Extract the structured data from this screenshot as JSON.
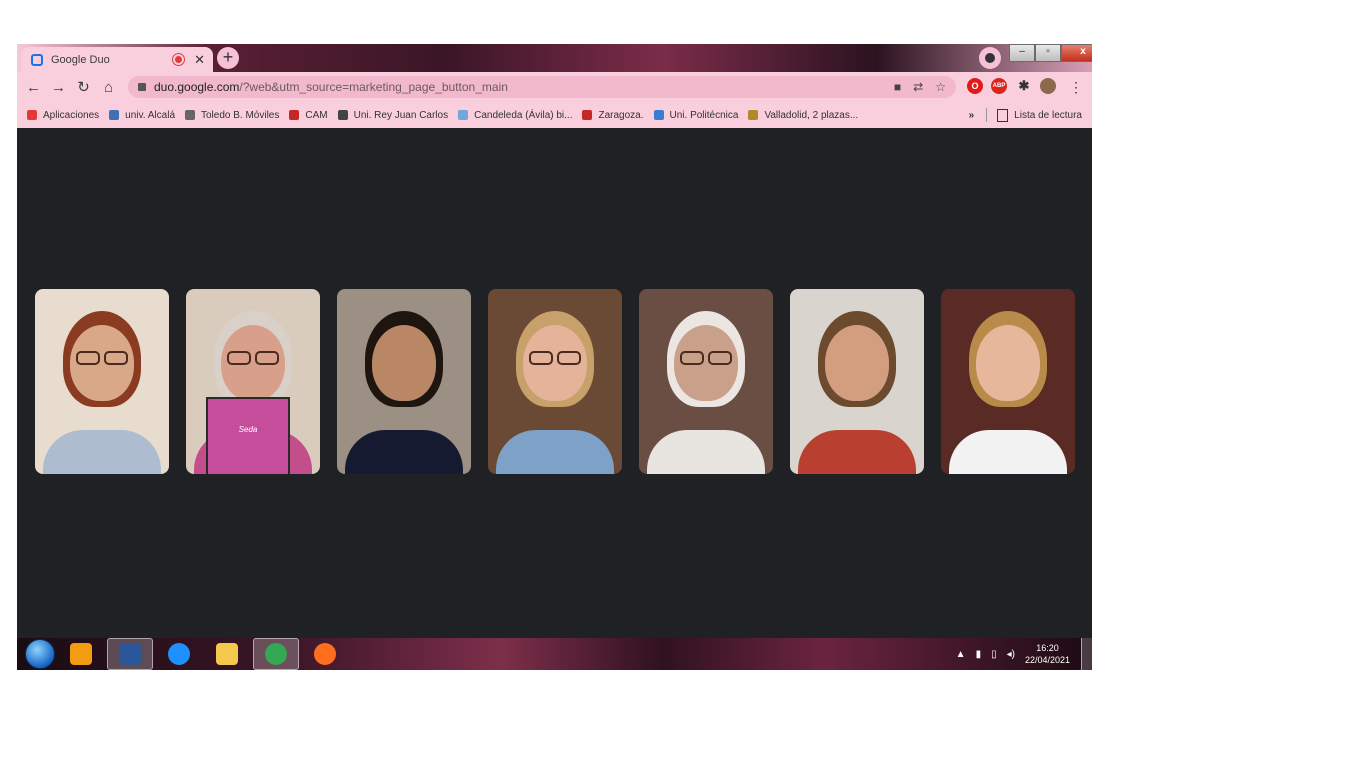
{
  "browser": {
    "tab_title": "Google Duo",
    "new_tab_label": "+",
    "url_main": "duo.google.com",
    "url_rest": "/?web&utm_source=marketing_page_button_main",
    "window_controls": [
      "–",
      "▫",
      "x"
    ]
  },
  "extensions": [
    {
      "name": "opera-icon",
      "label": "O",
      "color": "#e41a1a"
    },
    {
      "name": "adblock-icon",
      "label": "ABP",
      "color": "#d9261c"
    },
    {
      "name": "puzzle-icon",
      "label": "✱",
      "color": "#333333"
    }
  ],
  "bookmarks": {
    "items": [
      {
        "label": "Aplicaciones",
        "color": "#e53935"
      },
      {
        "label": "univ. Alcalá",
        "color": "#3f6fb5"
      },
      {
        "label": "Toledo B. Móviles",
        "color": "#666666"
      },
      {
        "label": "CAM",
        "color": "#c62828"
      },
      {
        "label": "Uni. Rey Juan Carlos",
        "color": "#444444"
      },
      {
        "label": "Candeleda (Ávila) bi...",
        "color": "#6fa8dc"
      },
      {
        "label": "Zaragoza.",
        "color": "#c62828"
      },
      {
        "label": "Uni. Politécnica",
        "color": "#3a7bd5"
      },
      {
        "label": "Valladolid, 2 plazas...",
        "color": "#b08a2a"
      }
    ],
    "overflow": "»",
    "reading_list": "Lista de lectura"
  },
  "participants": [
    {
      "skin": "#d9a888",
      "hair": "#8a3b22",
      "shirt": "#aebcd0",
      "bg": "#e8dccf",
      "glasses": true
    },
    {
      "skin": "#d8a08a",
      "hair": "#d9d1c9",
      "shirt": "#c44d8c",
      "bg": "#d9ccbd",
      "glasses": true,
      "book": "Seda"
    },
    {
      "skin": "#b98766",
      "hair": "#1e1510",
      "shirt": "#151a30",
      "bg": "#9c8f84",
      "glasses": false
    },
    {
      "skin": "#e4b39a",
      "hair": "#c8a06a",
      "shirt": "#7ea2c7",
      "bg": "#6a4a34",
      "glasses": true
    },
    {
      "skin": "#c9a08a",
      "hair": "#ece6e2",
      "shirt": "#e8e4e0",
      "bg": "#6b4e43",
      "glasses": true
    },
    {
      "skin": "#d39e80",
      "hair": "#6b4a2e",
      "shirt": "#b94030",
      "bg": "#d9d4cd",
      "glasses": false
    },
    {
      "skin": "#e7b79c",
      "hair": "#b98a4a",
      "shirt": "#f2f2f2",
      "bg": "#5a2a24",
      "glasses": false
    }
  ],
  "taskbar": {
    "time": "16:20",
    "date": "22/04/2021",
    "apps": [
      {
        "name": "media-player-icon",
        "color": "#f39c12"
      },
      {
        "name": "word-icon",
        "color": "#2b579a"
      },
      {
        "name": "internet-explorer-icon",
        "color": "#1e90ff"
      },
      {
        "name": "file-explorer-icon",
        "color": "#f2c94c"
      },
      {
        "name": "chrome-icon",
        "color": "#34a853"
      },
      {
        "name": "firefox-icon",
        "color": "#ff6d1f"
      }
    ]
  }
}
